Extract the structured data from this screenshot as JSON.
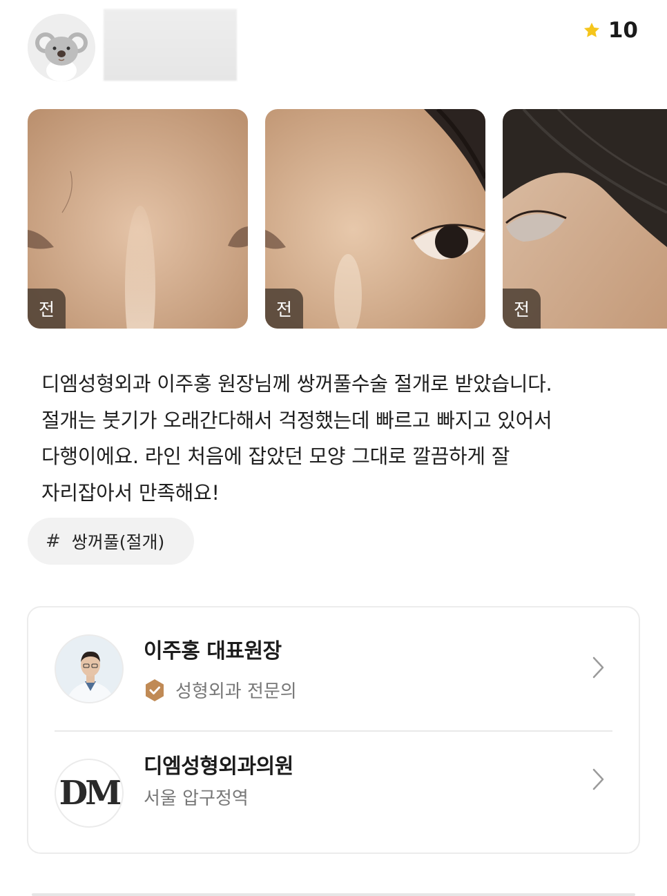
{
  "review": {
    "rating": "10",
    "photos": [
      {
        "badge": "전"
      },
      {
        "badge": "전"
      },
      {
        "badge": "전"
      }
    ],
    "text_lines": [
      "디엠성형외과 이주홍 원장님께 쌍꺼풀수술 절개로 받았습니다.",
      "절개는 붓기가 오래간다해서 걱정했는데 빠르고 빠지고 있어서",
      "다행이에요. 라인 처음에 잡았던 모양 그대로 깔끔하게 잘",
      "자리잡아서 만족해요!"
    ],
    "tag": {
      "hash": "#",
      "label": "쌍꺼풀(절개)"
    }
  },
  "doctor": {
    "name": "이주홍 대표원장",
    "credential": "성형외과 전문의"
  },
  "clinic": {
    "name": "디엠성형외과의원",
    "location": "서울 압구정역",
    "logo_text": "DM"
  },
  "colors": {
    "star": "#f5c51c",
    "badge_bg": "#4e4034",
    "verify": "#c08a55"
  }
}
